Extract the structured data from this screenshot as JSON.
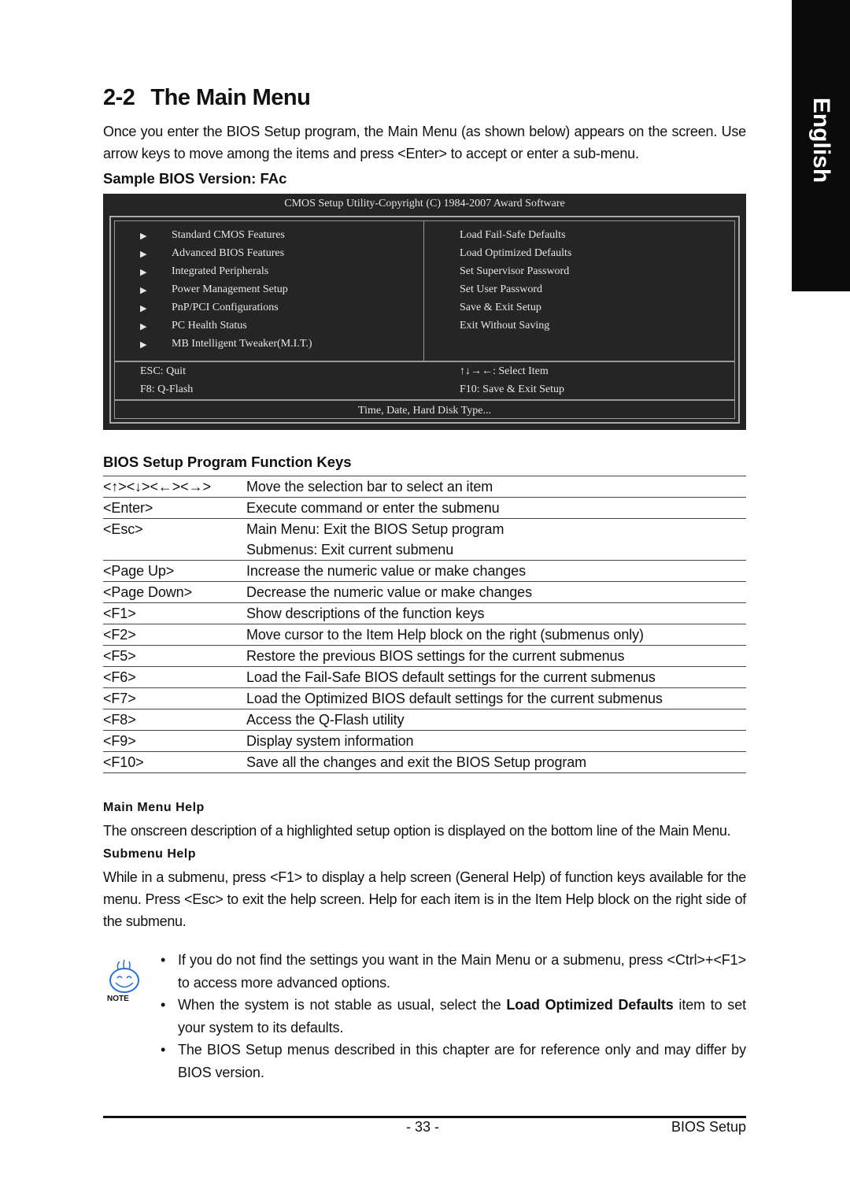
{
  "side_tab": {
    "label": "English"
  },
  "heading": {
    "number": "2-2",
    "title": "The Main Menu"
  },
  "intro": "Once you enter the BIOS Setup program, the Main Menu (as shown below) appears on the screen. Use arrow keys to move among the items and press <Enter> to accept or enter a sub-menu.",
  "sample_heading": "Sample BIOS Version: FAc",
  "bios_screen": {
    "title": "CMOS Setup Utility-Copyright (C) 1984-2007 Award Software",
    "arrow_glyph": "▶",
    "left_items": [
      "Standard CMOS Features",
      "Advanced BIOS Features",
      "Integrated Peripherals",
      "Power Management Setup",
      "PnP/PCI Configurations",
      "PC Health Status",
      "MB Intelligent Tweaker(M.I.T.)"
    ],
    "right_items": [
      "Load Fail-Safe Defaults",
      "Load Optimized Defaults",
      "Set Supervisor Password",
      "Set User Password",
      "Save & Exit Setup",
      "Exit Without Saving"
    ],
    "footer": {
      "esc": "ESC: Quit",
      "f8": "F8: Q-Flash",
      "select": "↑↓→←: Select Item",
      "f10": "F10: Save & Exit Setup"
    },
    "status_line": "Time, Date, Hard Disk Type..."
  },
  "keys_heading": "BIOS Setup Program Function Keys",
  "function_keys": [
    {
      "key": "<↑><↓><←><→>",
      "desc": [
        "Move the selection bar to select an item"
      ]
    },
    {
      "key": "<Enter>",
      "desc": [
        "Execute command or enter the submenu"
      ]
    },
    {
      "key": "<Esc>",
      "desc": [
        "Main Menu: Exit the BIOS Setup program",
        "Submenus: Exit current submenu"
      ]
    },
    {
      "key": "<Page Up>",
      "desc": [
        "Increase the numeric value or make changes"
      ]
    },
    {
      "key": "<Page Down>",
      "desc": [
        "Decrease the numeric value or make changes"
      ]
    },
    {
      "key": "<F1>",
      "desc": [
        "Show descriptions of the function keys"
      ]
    },
    {
      "key": "<F2>",
      "desc": [
        "Move cursor to the Item Help block on the right (submenus only)"
      ]
    },
    {
      "key": "<F5>",
      "desc": [
        "Restore the previous BIOS settings for the current submenus"
      ]
    },
    {
      "key": "<F6>",
      "desc": [
        "Load the Fail-Safe BIOS default settings for the current submenus"
      ]
    },
    {
      "key": "<F7>",
      "desc": [
        "Load the Optimized BIOS default settings for the current submenus"
      ]
    },
    {
      "key": "<F8>",
      "desc": [
        "Access the Q-Flash utility"
      ]
    },
    {
      "key": "<F9>",
      "desc": [
        "Display system information"
      ]
    },
    {
      "key": "<F10>",
      "desc": [
        "Save all the changes and exit the BIOS Setup program"
      ]
    }
  ],
  "main_menu_help": {
    "heading": "Main Menu Help",
    "text": "The onscreen description of a highlighted setup option is displayed on the bottom line of the Main Menu."
  },
  "submenu_help": {
    "heading": "Submenu Help",
    "text": "While in a submenu, press <F1> to display a help screen (General Help) of function keys available for the menu. Press <Esc> to exit the help screen. Help for each item is in the Item Help block on the right side of the submenu."
  },
  "note": {
    "icon_label": "NOTE",
    "bullet": "•",
    "items": [
      {
        "before": "If you do not find the settings you want in the Main Menu or a submenu, press <Ctrl>+<F1> to access more advanced options.",
        "bold": "",
        "after": ""
      },
      {
        "before": "When the system is not stable as usual, select the ",
        "bold": "Load Optimized Defaults",
        "after": " item to set your system to its defaults."
      },
      {
        "before": "The BIOS Setup menus described in this chapter are for reference only and may differ by BIOS version.",
        "bold": "",
        "after": ""
      }
    ]
  },
  "footer": {
    "page_number": "- 33 -",
    "section": "BIOS Setup"
  }
}
